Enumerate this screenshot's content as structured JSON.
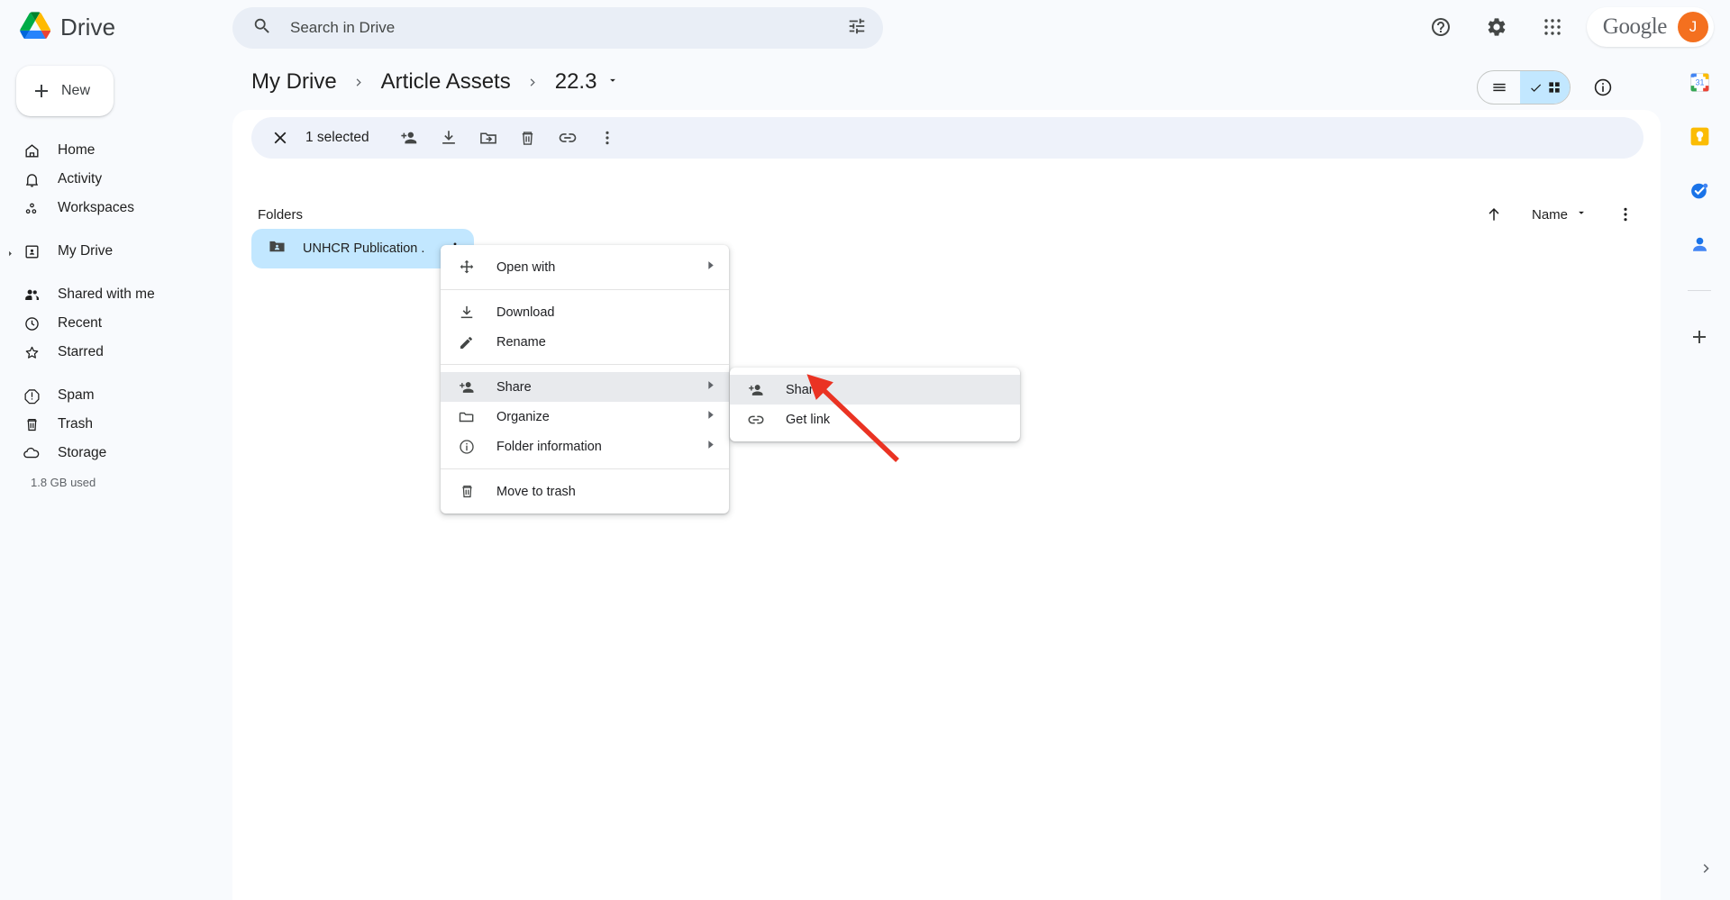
{
  "app": {
    "name": "Drive"
  },
  "search": {
    "placeholder": "Search in Drive",
    "value": "",
    "icon": "search-icon",
    "tune_icon": "tune-icon"
  },
  "topbar": {
    "help_icon": "help-icon",
    "settings_icon": "gear-icon",
    "apps_icon": "apps-grid-icon",
    "google_word": "Google",
    "avatar_initial": "J"
  },
  "sidebar": {
    "new_label": "New",
    "items": [
      {
        "label": "Home",
        "icon": "home-icon"
      },
      {
        "label": "Activity",
        "icon": "bell-icon"
      },
      {
        "label": "Workspaces",
        "icon": "workspaces-icon"
      },
      {
        "label": "My Drive",
        "icon": "my-drive-icon",
        "expandable": true
      },
      {
        "label": "Shared with me",
        "icon": "people-icon"
      },
      {
        "label": "Recent",
        "icon": "clock-icon"
      },
      {
        "label": "Starred",
        "icon": "star-icon"
      },
      {
        "label": "Spam",
        "icon": "spam-icon"
      },
      {
        "label": "Trash",
        "icon": "trash-icon"
      },
      {
        "label": "Storage",
        "icon": "cloud-icon"
      }
    ],
    "storage_used": "1.8 GB used"
  },
  "breadcrumb": {
    "items": [
      "My Drive",
      "Article Assets",
      "22.3"
    ],
    "current_has_caret": true
  },
  "view": {
    "list_icon": "list-view-icon",
    "grid_icon": "grid-view-icon",
    "grid_active": true,
    "check_icon": "check-icon",
    "info_icon": "info-circle-icon"
  },
  "selection_toolbar": {
    "close_icon": "close-icon",
    "count_label": "1 selected",
    "actions": [
      {
        "name": "share-button",
        "icon": "person-add-icon"
      },
      {
        "name": "download-button",
        "icon": "download-icon"
      },
      {
        "name": "move-button",
        "icon": "folder-move-icon"
      },
      {
        "name": "trash-button",
        "icon": "trash-icon"
      },
      {
        "name": "get-link-button",
        "icon": "link-icon"
      },
      {
        "name": "more-actions-button",
        "icon": "kebab-icon"
      }
    ]
  },
  "section": {
    "title": "Folders",
    "sort_direction_icon": "arrow-up-icon",
    "sort_label": "Name",
    "sort_caret_icon": "caret-down-icon",
    "more_icon": "kebab-icon"
  },
  "folders": [
    {
      "name": "UNHCR Publication ...",
      "icon": "shared-folder-icon",
      "selected": true,
      "kebab_icon": "kebab-icon"
    }
  ],
  "context_menu": {
    "groups": [
      [
        {
          "label": "Open with",
          "icon": "open-with-icon",
          "submenu": true
        }
      ],
      [
        {
          "label": "Download",
          "icon": "download-icon",
          "submenu": false
        },
        {
          "label": "Rename",
          "icon": "pencil-icon",
          "submenu": false
        }
      ],
      [
        {
          "label": "Share",
          "icon": "person-add-icon",
          "submenu": true,
          "highlighted": true
        },
        {
          "label": "Organize",
          "icon": "folder-icon",
          "submenu": true
        },
        {
          "label": "Folder information",
          "icon": "info-circle-icon",
          "submenu": true
        }
      ],
      [
        {
          "label": "Move to trash",
          "icon": "trash-icon",
          "submenu": false
        }
      ]
    ]
  },
  "share_submenu": {
    "items": [
      {
        "label": "Share",
        "icon": "person-add-icon",
        "highlighted": true
      },
      {
        "label": "Get link",
        "icon": "link-icon",
        "highlighted": false
      }
    ]
  },
  "right_rail": {
    "items": [
      {
        "name": "calendar-icon",
        "label": "31"
      },
      {
        "name": "keep-icon"
      },
      {
        "name": "tasks-icon"
      },
      {
        "name": "contacts-icon"
      }
    ],
    "add_icon": "plus-icon",
    "expand_icon": "chevron-right-icon"
  },
  "annotation": {
    "arrow_color": "#ea3323"
  }
}
